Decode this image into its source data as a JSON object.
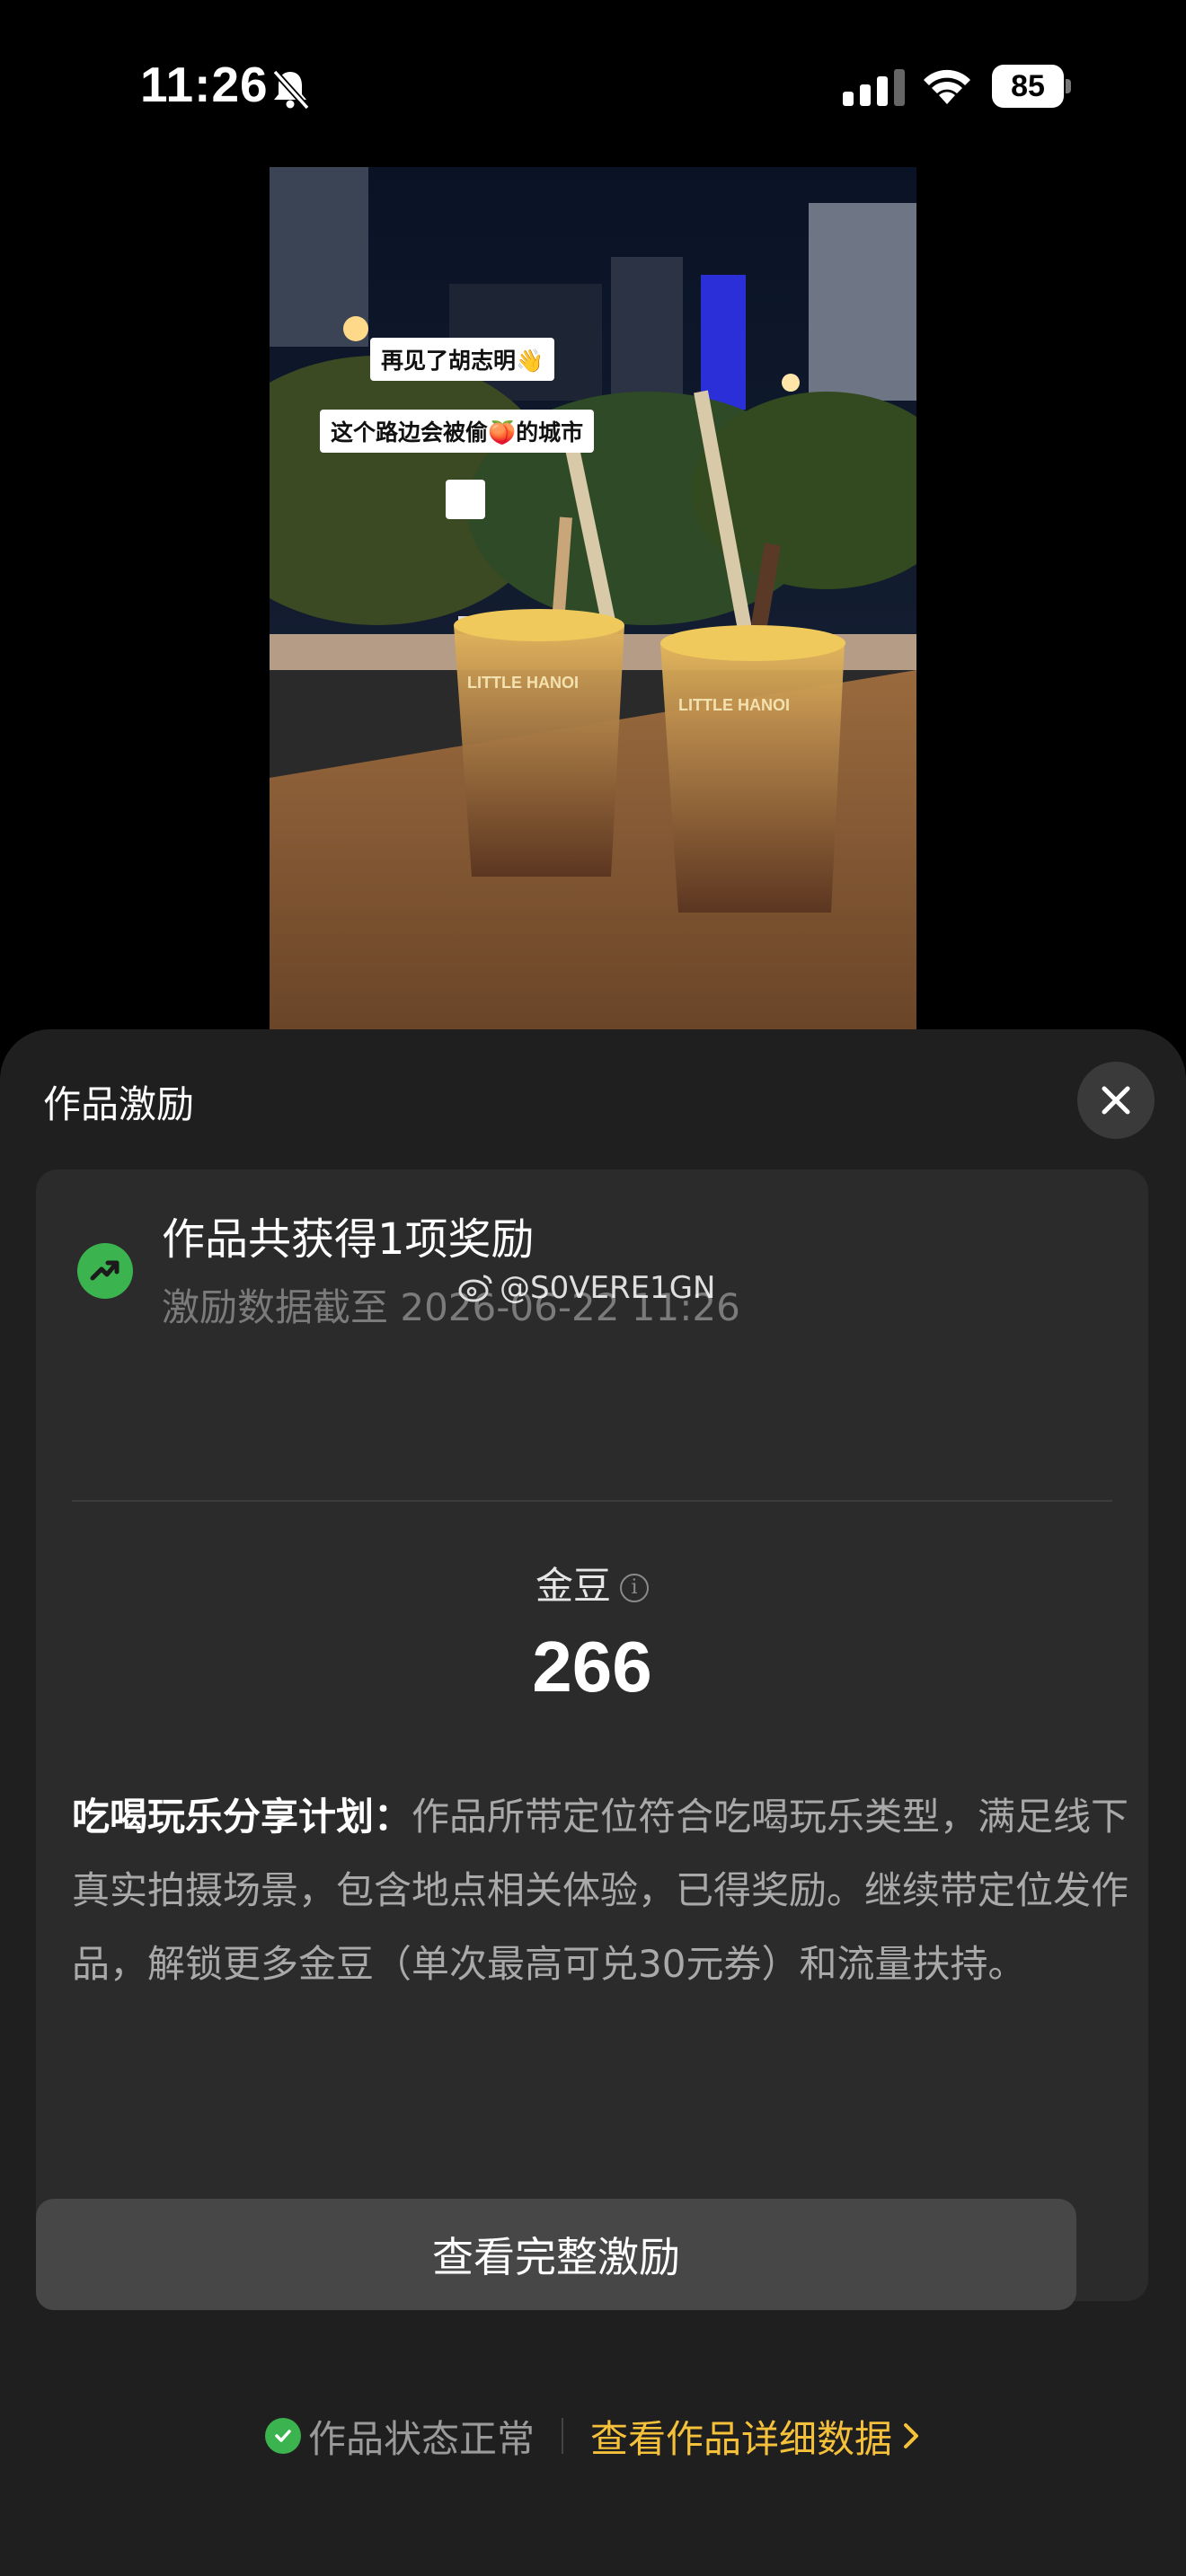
{
  "status_bar": {
    "time": "11:26",
    "battery": "85",
    "icons": [
      "silent-bell-icon",
      "cellular-signal-icon",
      "wifi-icon",
      "battery-icon"
    ]
  },
  "thumbnail": {
    "caption_1": "再见了胡志明👋",
    "caption_2": "这个路边会被偷🍑的城市",
    "cup_brand": "LITTLE HANOI"
  },
  "sheet": {
    "title": "作品激励",
    "close_icon": "close-icon",
    "award": {
      "title": "作品共获得1项奖励",
      "date": "激励数据截至 2026-06-22 11:26",
      "icon": "trend-up-icon"
    },
    "watermark": "@S0VERE1GN",
    "coin": {
      "label": "金豆",
      "value": "266"
    },
    "plan": {
      "name": "吃喝玩乐分享计划：",
      "description": "作品所带定位符合吃喝玩乐类型，满足线下真实拍摄场景，包含地点相关体验，已得奖励。继续带定位发作品，解锁更多金豆（单次最高可兑30元券）和流量扶持。"
    },
    "full_button": "查看完整激励"
  },
  "footer": {
    "status": "作品状态正常",
    "detail_link": "查看作品详细数据"
  },
  "colors": {
    "sheet_bg": "#1f1f1f",
    "card_bg": "#2b2b2b",
    "accent_green": "#3bb34f",
    "link_yellow": "#f5c13a"
  }
}
